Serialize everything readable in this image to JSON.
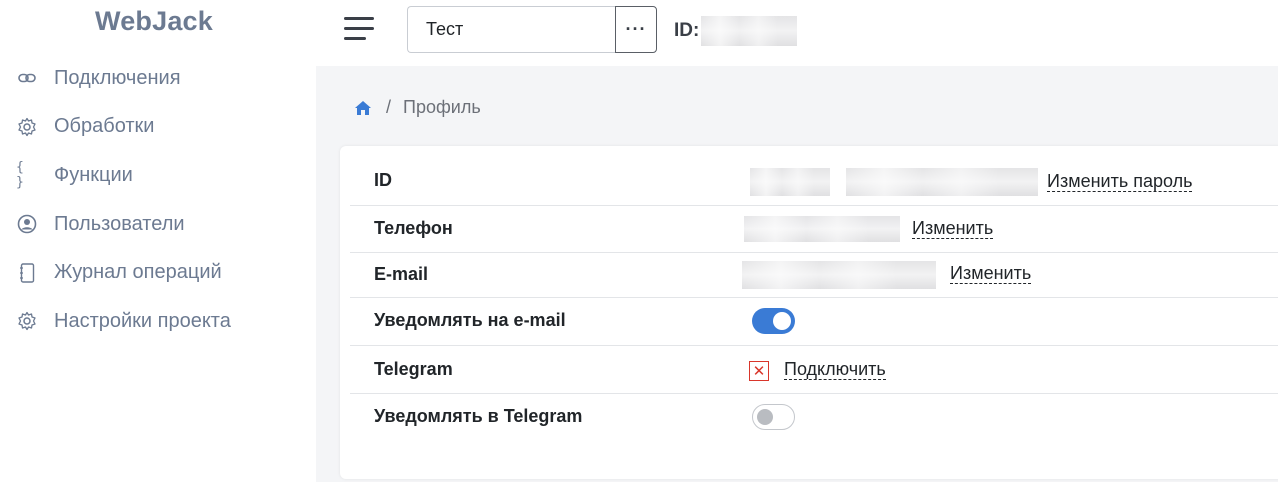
{
  "app": {
    "logo": "WebJack"
  },
  "sidebar": {
    "items": [
      {
        "label": "Подключения",
        "icon": "link-icon"
      },
      {
        "label": "Обработки",
        "icon": "gear-icon"
      },
      {
        "label": "Функции",
        "icon": "braces-icon"
      },
      {
        "label": "Пользователи",
        "icon": "user-circle-icon"
      },
      {
        "label": "Журнал операций",
        "icon": "notebook-icon"
      },
      {
        "label": "Настройки проекта",
        "icon": "gear-icon"
      }
    ]
  },
  "header": {
    "project_name": "Тест",
    "more_label": "···",
    "id_label": "ID:"
  },
  "breadcrumb": {
    "separator": "/",
    "current": "Профиль"
  },
  "profile": {
    "id": {
      "label": "ID",
      "action": "Изменить пароль"
    },
    "phone": {
      "label": "Телефон",
      "action": "Изменить"
    },
    "email": {
      "label": "E-mail",
      "action": "Изменить"
    },
    "notify_email": {
      "label": "Уведомлять на e-mail",
      "enabled": true
    },
    "telegram": {
      "label": "Telegram",
      "action": "Подключить",
      "status_icon": "x-square-icon"
    },
    "notify_telegram": {
      "label": "Уведомлять в Telegram",
      "enabled": false
    }
  },
  "colors": {
    "accent": "#3a7bd5",
    "error": "#d9362b",
    "muted": "#6c7a91"
  }
}
